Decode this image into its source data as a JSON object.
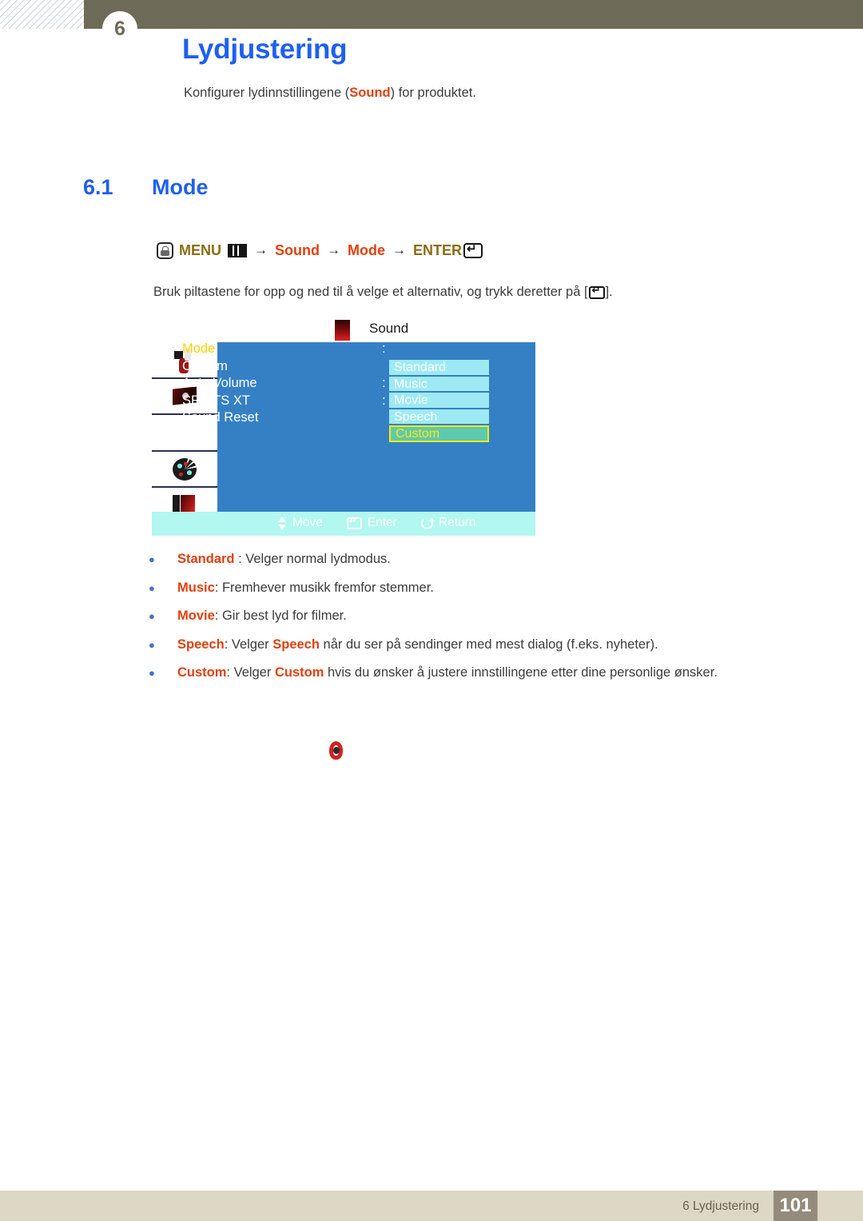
{
  "header": {
    "chapter_number": "6",
    "title": "Lydjustering",
    "subtitle_before": "Konfigurer lydinnstillingene (",
    "subtitle_keyword": "Sound",
    "subtitle_after": ") for produktet."
  },
  "section": {
    "number": "6.1",
    "title": "Mode"
  },
  "menu_path": {
    "menu_label": "MENU",
    "arrow1": "→",
    "item1": "Sound",
    "arrow2": "→",
    "item2": "Mode",
    "arrow3": "→",
    "enter_label": "ENTER",
    "hand_icon": "hand-press-icon",
    "bars_icon": "menu-bars-icon",
    "enter_icon": "enter-key-icon"
  },
  "instruction": {
    "before": "Bruk piltastene for opp og ned til å velge et alternativ, og trykk deretter på [",
    "after": "]."
  },
  "osd": {
    "title": "Sound",
    "sidebar_icons": [
      "picture-icon",
      "screen-icon",
      "osd-icon",
      "setup-icon",
      "multi-control-icon"
    ],
    "rows": [
      {
        "label": "Mode",
        "colon": ":",
        "active": true
      },
      {
        "label": "Custom",
        "colon": "",
        "active": false
      },
      {
        "label": "Auto Volume",
        "colon": ":",
        "active": false
      },
      {
        "label": "SRS TS XT",
        "colon": ":",
        "active": false
      },
      {
        "label": "Sound Reset",
        "colon": "",
        "active": false
      }
    ],
    "dropdown": [
      {
        "label": "Standard",
        "selected": false
      },
      {
        "label": "Music",
        "selected": false
      },
      {
        "label": "Movie",
        "selected": false
      },
      {
        "label": "Speech",
        "selected": false
      },
      {
        "label": "Custom",
        "selected": true
      }
    ],
    "hints": [
      {
        "icon": "up-down-arrows-icon",
        "label": "Move"
      },
      {
        "icon": "enter-key-icon",
        "label": "Enter"
      },
      {
        "icon": "return-arrow-icon",
        "label": "Return"
      }
    ],
    "colors": {
      "panel": "#3580c4",
      "dropdown_item": "#9deaf5",
      "dropdown_selected": "#5fc9b0",
      "dropdown_selected_border": "#ffe900",
      "bottom_bar": "#b2f7f0",
      "active_row_text": "#ffd200"
    }
  },
  "bullets": [
    {
      "term": "Standard",
      "sep": " : ",
      "text_before": "Velger normal lydmodus.",
      "highlight": "",
      "text_after": ""
    },
    {
      "term": "Music",
      "sep": ": ",
      "text_before": "Fremhever musikk fremfor stemmer.",
      "highlight": "",
      "text_after": ""
    },
    {
      "term": "Movie",
      "sep": ": ",
      "text_before": "Gir best lyd for filmer.",
      "highlight": "",
      "text_after": ""
    },
    {
      "term": "Speech",
      "sep": ": ",
      "text_before": "Velger ",
      "highlight": "Speech",
      "text_after": " når du ser på sendinger med mest dialog (f.eks. nyheter)."
    },
    {
      "term": "Custom",
      "sep": ": ",
      "text_before": "Velger ",
      "highlight": "Custom",
      "text_after": " hvis du ønsker å justere innstillingene etter dine personlige ønsker."
    }
  ],
  "footer": {
    "text": "6 Lydjustering",
    "page": "101"
  },
  "theme": {
    "header_bar": "#6d6b57",
    "heading_blue": "#1f5ff0",
    "keyword_red": "#e2400f",
    "gold": "#8a6d13",
    "footer_bar": "#ddd7c6",
    "footer_page_bg": "#958b7c"
  }
}
